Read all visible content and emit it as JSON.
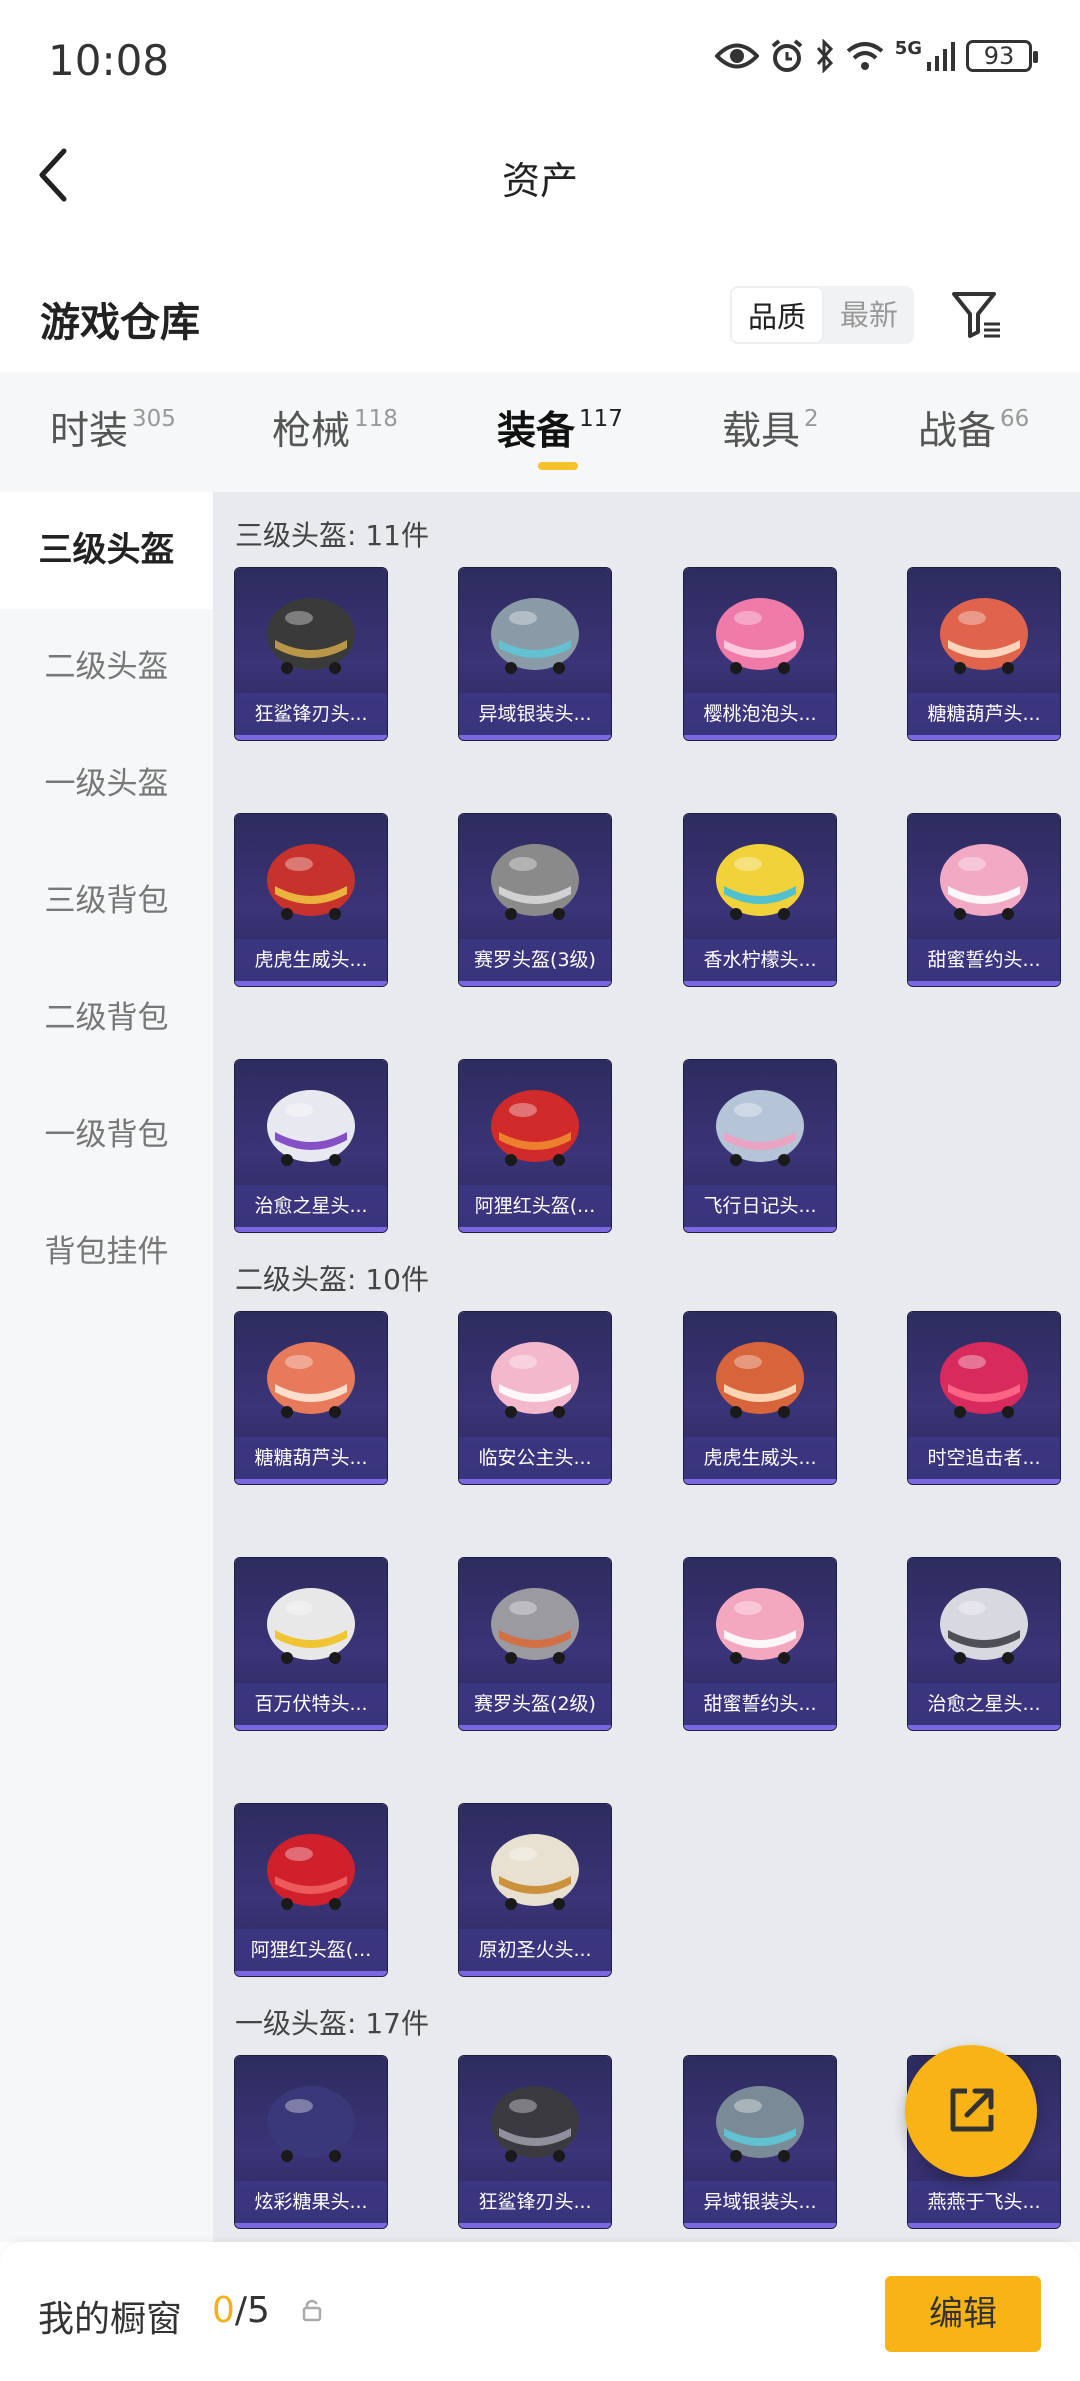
{
  "status_bar": {
    "time": "10:08",
    "network": "5G",
    "battery": "93"
  },
  "nav": {
    "title": "资产"
  },
  "warehouse": {
    "label": "游戏仓库",
    "sort_options": [
      "品质",
      "最新"
    ],
    "sort_selected": "品质"
  },
  "tabs": [
    {
      "label": "时装",
      "count": "305"
    },
    {
      "label": "枪械",
      "count": "118"
    },
    {
      "label": "装备",
      "count": "117",
      "active": true
    },
    {
      "label": "载具",
      "count": "2"
    },
    {
      "label": "战备",
      "count": "66"
    }
  ],
  "sidebar": [
    {
      "label": "三级头盔",
      "active": true
    },
    {
      "label": "二级头盔"
    },
    {
      "label": "一级头盔"
    },
    {
      "label": "三级背包"
    },
    {
      "label": "二级背包"
    },
    {
      "label": "一级背包"
    },
    {
      "label": "背包挂件"
    }
  ],
  "sections": [
    {
      "title": "三级头盔: 11件",
      "items": [
        {
          "name": "狂鲨锋刃头...",
          "color": "#3a3a3a",
          "accent": "#c9a24a"
        },
        {
          "name": "异域银装头...",
          "color": "#8a9aa6",
          "accent": "#5ec7d6"
        },
        {
          "name": "樱桃泡泡头...",
          "color": "#f07aa8",
          "accent": "#ffd0e2"
        },
        {
          "name": "糖糖葫芦头...",
          "color": "#e0644c",
          "accent": "#ffe0c8"
        },
        {
          "name": "虎虎生威头...",
          "color": "#c8322c",
          "accent": "#f0c040"
        },
        {
          "name": "赛罗头盔(3级)",
          "color": "#8a8a8a",
          "accent": "#d8d8d8"
        },
        {
          "name": "香水柠檬头...",
          "color": "#f2d23a",
          "accent": "#3ec0e0"
        },
        {
          "name": "甜蜜誓约头...",
          "color": "#f2a9c4",
          "accent": "#ffffff"
        },
        {
          "name": "治愈之星头...",
          "color": "#e8e8f0",
          "accent": "#7a3fc0"
        },
        {
          "name": "阿狸红头盔(...",
          "color": "#d02a2a",
          "accent": "#f08a30"
        },
        {
          "name": "飞行日记头...",
          "color": "#b6c4d8",
          "accent": "#f0a0c0"
        }
      ]
    },
    {
      "title": "二级头盔: 10件",
      "items": [
        {
          "name": "糖糖葫芦头...",
          "color": "#e87a5c",
          "accent": "#ffe8d8"
        },
        {
          "name": "临安公主头...",
          "color": "#f4b8cc",
          "accent": "#ffffff"
        },
        {
          "name": "虎虎生威头...",
          "color": "#d8643c",
          "accent": "#ffe0c0"
        },
        {
          "name": "时空追击者...",
          "color": "#d82a5c",
          "accent": "#ff6a8a"
        },
        {
          "name": "百万伏特头...",
          "color": "#e8e8e8",
          "accent": "#f2c020"
        },
        {
          "name": "赛罗头盔(2级)",
          "color": "#9a9aa0",
          "accent": "#d86a3a"
        },
        {
          "name": "甜蜜誓约头...",
          "color": "#f4a8c0",
          "accent": "#ffffff"
        },
        {
          "name": "治愈之星头...",
          "color": "#d8d8e0",
          "accent": "#404048"
        },
        {
          "name": "阿狸红头盔(...",
          "color": "#d0202c",
          "accent": "#f06060"
        },
        {
          "name": "原初圣火头...",
          "color": "#e8e0d0",
          "accent": "#c88a2a"
        }
      ]
    },
    {
      "title": "一级头盔: 17件",
      "items": [
        {
          "name": "炫彩糖果头...",
          "color": "#3a3878",
          "accent": "#3a3878"
        },
        {
          "name": "狂鲨锋刃头...",
          "color": "#3a3a40",
          "accent": "#9a9aa6"
        },
        {
          "name": "异域银装头...",
          "color": "#7a8a96",
          "accent": "#5ec7d6"
        },
        {
          "name": "燕燕于飞头...",
          "color": "#d06a8a",
          "accent": "#ffffff"
        }
      ]
    }
  ],
  "bottom": {
    "label": "我的橱窗",
    "current": "0",
    "total": "/5",
    "edit_label": "编辑"
  }
}
